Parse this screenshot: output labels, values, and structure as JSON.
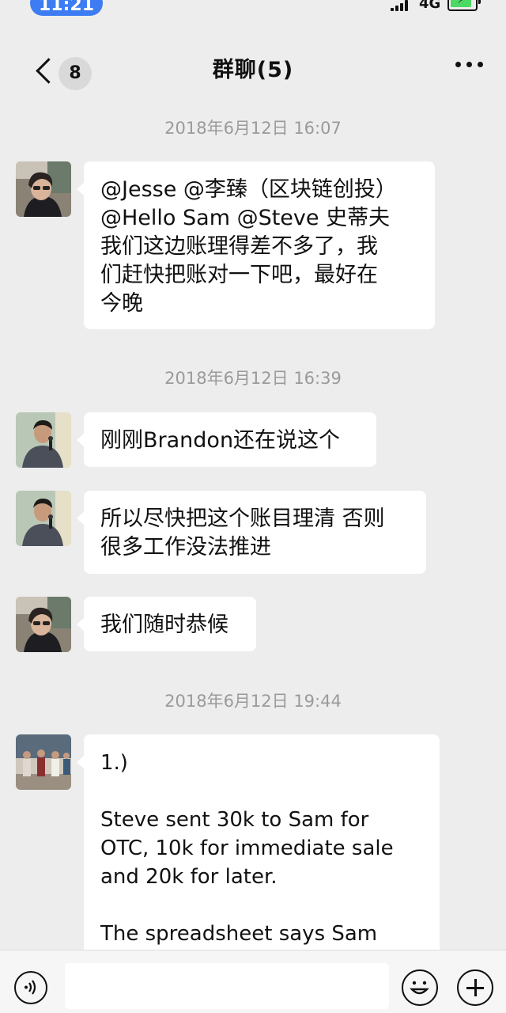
{
  "status_bar": {
    "time": "11:21",
    "network": "4G"
  },
  "nav": {
    "back_badge": "8",
    "title": "群聊(5)"
  },
  "messages": [
    {
      "timestamp": "2018年6月12日 16:07",
      "avatar": "woman-sunglasses-avatar",
      "text": "@Jesse @李臻（区块链创投）\n@Hello Sam @Steve 史蒂夫\n我们这边账理得差不多了，我\n们赶快把账对一下吧，最好在\n今晚"
    },
    {
      "timestamp": "2018年6月12日 16:39",
      "avatar": "man-microphone-avatar",
      "text": "刚刚Brandon还在说这个"
    },
    {
      "avatar": "man-microphone-avatar",
      "text": "所以尽快把这个账目理清 否则\n很多工作没法推进"
    },
    {
      "avatar": "woman-sunglasses-avatar",
      "text": "我们随时恭候"
    },
    {
      "timestamp": "2018年6月12日 19:44",
      "avatar": "group-photo-avatar",
      "text": "1.)\n\nSteve sent 30k to Sam for\nOTC, 10k for immediate sale\nand 20k for later.\n\nThe spreadsheet says Sam"
    }
  ],
  "input_bar": {
    "voice_icon": "voice-icon",
    "emoji_icon": "emoji-icon",
    "plus_icon": "plus-icon"
  },
  "colors": {
    "background": "#ededed",
    "bubble": "#ffffff",
    "timestamp": "#9a9a9a",
    "time_pill": "#3d7cf2"
  }
}
